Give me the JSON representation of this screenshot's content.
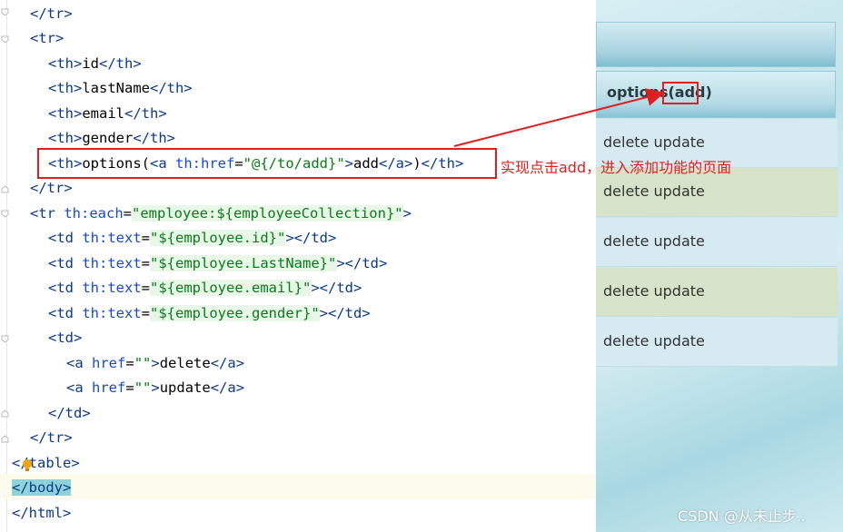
{
  "code": {
    "l1_close_tr": "</tr>",
    "l2_tr": "<tr>",
    "l3": {
      "open": "<th>",
      "text": "id",
      "close": "</th>"
    },
    "l4": {
      "open": "<th>",
      "text": "lastName",
      "close": "</th>"
    },
    "l5": {
      "open": "<th>",
      "text": "email",
      "close": "</th>"
    },
    "l6": {
      "open": "<th>",
      "text": "gender",
      "close": "</th>"
    },
    "l7": {
      "open": "<th>",
      "text1": "options(",
      "a_open": "<a",
      "attr": "th:href",
      "eq": "=",
      "val": "\"@{/to/add}\"",
      "gt": ">",
      "text2": "add",
      "a_close": "</a>",
      "text3": ")",
      "close": "</th>"
    },
    "l8_close_tr": "</tr>",
    "l9": {
      "open": "<tr",
      "attr": "th:each",
      "eq": "=",
      "val": "\"employee:${employeeCollection}\"",
      "gt": ">"
    },
    "l10": {
      "open": "<td",
      "attr": "th:text",
      "eq": "=",
      "val": "\"${employee.id}\"",
      "gt": ">",
      "close": "</td>"
    },
    "l11": {
      "open": "<td",
      "attr": "th:text",
      "eq": "=",
      "val": "\"${employee.LastName}\"",
      "gt": ">",
      "close": "</td>"
    },
    "l12": {
      "open": "<td",
      "attr": "th:text",
      "eq": "=",
      "val": "\"${employee.email}\"",
      "gt": ">",
      "close": "</td>"
    },
    "l13": {
      "open": "<td",
      "attr": "th:text",
      "eq": "=",
      "val": "\"${employee.gender}\"",
      "gt": ">",
      "close": "</td>"
    },
    "l14_td": "<td>",
    "l15": {
      "open": "<a",
      "attr": "href",
      "eq": "=",
      "val": "\"\"",
      "gt": ">",
      "text": "delete",
      "close": "</a>"
    },
    "l16": {
      "open": "<a",
      "attr": "href",
      "eq": "=",
      "val": "\"\"",
      "gt": ">",
      "text": "update",
      "close": "</a>"
    },
    "l17_close_td": "</td>",
    "l18_close_tr": "</tr>",
    "l19": {
      "lt": "<",
      "rest": "/table>"
    },
    "l20": {
      "open": "</body",
      "gt": ">"
    },
    "l21_close_html": "</html>"
  },
  "annotation": "实现点击add，进入添加功能的页面",
  "browser": {
    "header_label": "options(add)",
    "rows": [
      "delete update",
      "delete update",
      "delete update",
      "delete update",
      "delete update"
    ]
  },
  "watermark": "CSDN @从未止步..",
  "colors": {
    "annotation_red": "#e02020",
    "tag_blue": "#0b3a8c",
    "string_green": "#067d17"
  }
}
